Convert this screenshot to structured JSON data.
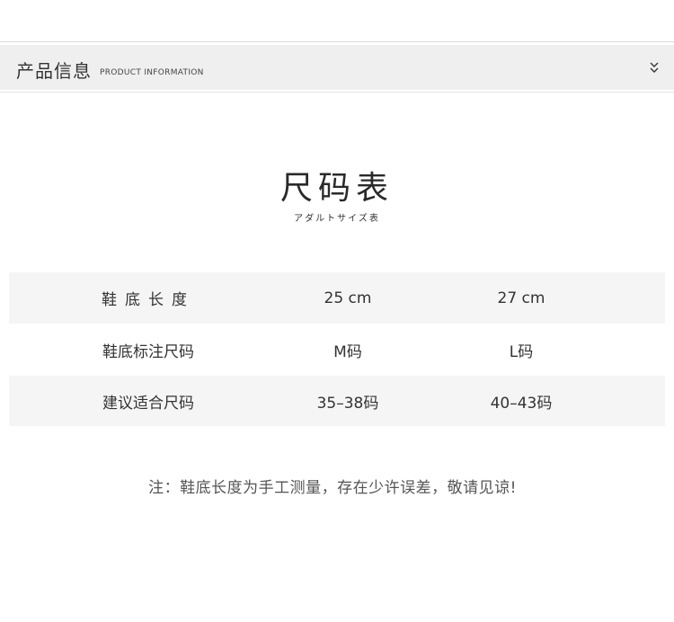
{
  "section": {
    "title": "产品信息",
    "subtitle": "PRODUCT INFORMATION",
    "toggle_icon": "double-chevron-down-icon"
  },
  "heading": {
    "title": "尺码表",
    "subtitle": "アダルトサイズ表"
  },
  "size_table": {
    "rows": [
      {
        "label": "鞋底长度",
        "values": [
          "25 cm",
          "27 cm"
        ]
      },
      {
        "label": "鞋底标注尺码",
        "values": [
          "M码",
          "L码"
        ]
      },
      {
        "label": "建议适合尺码",
        "values": [
          "35–38码",
          "40–43码"
        ]
      }
    ]
  },
  "note": "注：鞋底长度为手工测量，存在少许误差，敬请见谅!",
  "colors": {
    "bar_background": "#efefef",
    "row_shade": "#f5f5f5",
    "text": "#333333"
  }
}
